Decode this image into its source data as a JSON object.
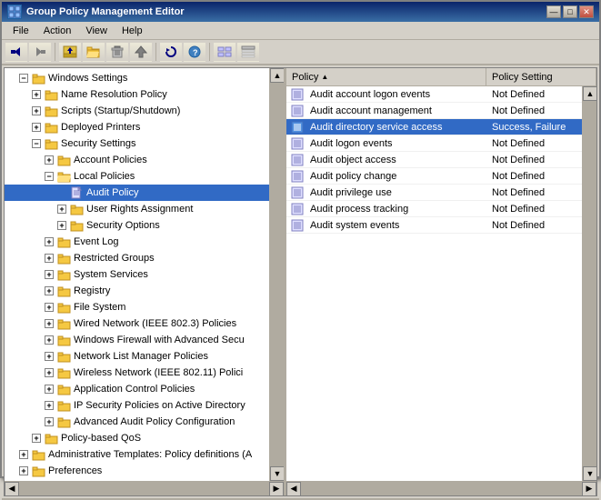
{
  "titleBar": {
    "title": "Group Policy Management Editor",
    "icon": "gp-icon",
    "buttons": [
      "minimize",
      "maximize",
      "close"
    ]
  },
  "menuBar": {
    "items": [
      "File",
      "Action",
      "View",
      "Help"
    ]
  },
  "toolbar": {
    "buttons": [
      "back",
      "forward",
      "up",
      "folder-open",
      "delete",
      "move",
      "refresh",
      "info",
      "list",
      "detail"
    ]
  },
  "treePane": {
    "nodes": [
      {
        "id": "windows-settings",
        "label": "Windows Settings",
        "expanded": true,
        "indent": 1,
        "icon": "folder",
        "children": [
          {
            "id": "name-resolution",
            "label": "Name Resolution Policy",
            "indent": 2,
            "icon": "folder",
            "expanded": false
          },
          {
            "id": "scripts",
            "label": "Scripts (Startup/Shutdown)",
            "indent": 2,
            "icon": "folder",
            "expanded": false
          },
          {
            "id": "deployed-printers",
            "label": "Deployed Printers",
            "indent": 2,
            "icon": "folder",
            "expanded": false
          },
          {
            "id": "security-settings",
            "label": "Security Settings",
            "indent": 2,
            "icon": "folder",
            "expanded": true,
            "children": [
              {
                "id": "account-policies",
                "label": "Account Policies",
                "indent": 3,
                "icon": "folder",
                "expanded": false
              },
              {
                "id": "local-policies",
                "label": "Local Policies",
                "indent": 3,
                "icon": "folder-open",
                "expanded": true,
                "children": [
                  {
                    "id": "audit-policy",
                    "label": "Audit Policy",
                    "indent": 4,
                    "icon": "doc",
                    "selected": true,
                    "expanded": false
                  },
                  {
                    "id": "user-rights",
                    "label": "User Rights Assignment",
                    "indent": 4,
                    "icon": "folder",
                    "expanded": false
                  },
                  {
                    "id": "security-options",
                    "label": "Security Options",
                    "indent": 4,
                    "icon": "folder",
                    "expanded": false
                  }
                ]
              },
              {
                "id": "event-log",
                "label": "Event Log",
                "indent": 3,
                "icon": "folder",
                "expanded": false
              },
              {
                "id": "restricted-groups",
                "label": "Restricted Groups",
                "indent": 3,
                "icon": "folder",
                "expanded": false
              },
              {
                "id": "system-services",
                "label": "System Services",
                "indent": 3,
                "icon": "folder",
                "expanded": false
              },
              {
                "id": "registry",
                "label": "Registry",
                "indent": 3,
                "icon": "folder",
                "expanded": false
              },
              {
                "id": "file-system",
                "label": "File System",
                "indent": 3,
                "icon": "folder",
                "expanded": false
              },
              {
                "id": "wired-network",
                "label": "Wired Network (IEEE 802.3) Policies",
                "indent": 3,
                "icon": "folder",
                "expanded": false
              },
              {
                "id": "windows-firewall",
                "label": "Windows Firewall with Advanced Secu",
                "indent": 3,
                "icon": "folder",
                "expanded": false
              },
              {
                "id": "network-list",
                "label": "Network List Manager Policies",
                "indent": 3,
                "icon": "folder",
                "expanded": false
              },
              {
                "id": "wireless-network",
                "label": "Wireless Network (IEEE 802.11) Polici",
                "indent": 3,
                "icon": "folder",
                "expanded": false
              },
              {
                "id": "application-control",
                "label": "Application Control Policies",
                "indent": 3,
                "icon": "folder",
                "expanded": false
              },
              {
                "id": "ip-security",
                "label": "IP Security Policies on Active Directory",
                "indent": 3,
                "icon": "folder",
                "expanded": false
              },
              {
                "id": "advanced-audit",
                "label": "Advanced Audit Policy Configuration",
                "indent": 3,
                "icon": "folder",
                "expanded": false
              }
            ]
          },
          {
            "id": "policy-based-qos",
            "label": "Policy-based QoS",
            "indent": 2,
            "icon": "folder",
            "expanded": false
          }
        ]
      },
      {
        "id": "admin-templates",
        "label": "Administrative Templates: Policy definitions (A",
        "indent": 1,
        "icon": "folder",
        "expanded": false
      },
      {
        "id": "preferences",
        "label": "Preferences",
        "indent": 1,
        "icon": "folder",
        "expanded": false
      }
    ]
  },
  "listPane": {
    "columns": [
      {
        "id": "policy",
        "label": "Policy",
        "sortIcon": "▲"
      },
      {
        "id": "setting",
        "label": "Policy Setting"
      }
    ],
    "rows": [
      {
        "id": "audit-account-logon",
        "policy": "Audit account logon events",
        "setting": "Not Defined",
        "selected": false
      },
      {
        "id": "audit-account-management",
        "policy": "Audit account management",
        "setting": "Not Defined",
        "selected": false
      },
      {
        "id": "audit-directory-service",
        "policy": "Audit directory service access",
        "setting": "Success, Failure",
        "selected": true
      },
      {
        "id": "audit-logon-events",
        "policy": "Audit logon events",
        "setting": "Not Defined",
        "selected": false
      },
      {
        "id": "audit-object-access",
        "policy": "Audit object access",
        "setting": "Not Defined",
        "selected": false
      },
      {
        "id": "audit-policy-change",
        "policy": "Audit policy change",
        "setting": "Not Defined",
        "selected": false
      },
      {
        "id": "audit-privilege-use",
        "policy": "Audit privilege use",
        "setting": "Not Defined",
        "selected": false
      },
      {
        "id": "audit-process-tracking",
        "policy": "Audit process tracking",
        "setting": "Not Defined",
        "selected": false
      },
      {
        "id": "audit-system-events",
        "policy": "Audit system events",
        "setting": "Not Defined",
        "selected": false
      }
    ]
  },
  "statusBar": {
    "text": ""
  },
  "icons": {
    "folder": "📁",
    "folder_open": "📂",
    "doc": "📄",
    "policy_doc": "📋",
    "back": "◀",
    "forward": "▶",
    "up": "↑",
    "folder_btn": "📁",
    "delete": "✖",
    "move": "✂",
    "refresh": "↻",
    "info": "❓",
    "list": "☰",
    "detail": "⊞",
    "minimize": "—",
    "maximize": "□",
    "close": "✕",
    "sort_asc": "▲"
  }
}
